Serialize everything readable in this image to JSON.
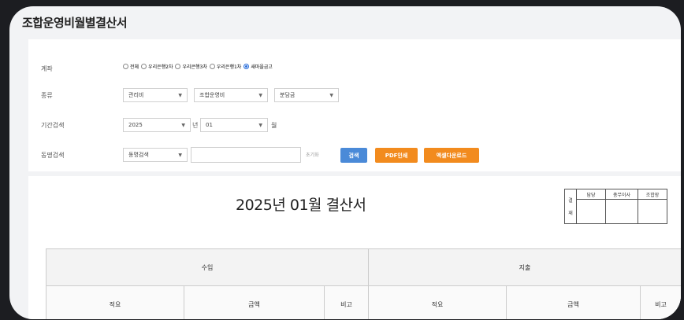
{
  "page": {
    "title": "조합운영비월별결산서"
  },
  "filters": {
    "account": {
      "label": "계좌",
      "options": [
        {
          "label": "전체",
          "checked": false
        },
        {
          "label": "우리은행2차",
          "checked": false
        },
        {
          "label": "우리은행3차",
          "checked": false
        },
        {
          "label": "우리은행1차",
          "checked": false
        },
        {
          "label": "새마을금고",
          "checked": true
        }
      ]
    },
    "category": {
      "label": "종류",
      "select1": "관리비",
      "select2": "조합운영비",
      "select3": "분담금"
    },
    "period": {
      "label": "기간검색",
      "year": "2025",
      "year_unit": "년",
      "month": "01",
      "month_unit": "월"
    },
    "member": {
      "label": "동명검색",
      "select": "동명검색",
      "input_value": "",
      "reset_label": "초기화"
    },
    "buttons": {
      "search": "검색",
      "pdf": "PDF인쇄",
      "excel": "엑셀다운로드"
    }
  },
  "sheet": {
    "title": "2025년 01월 결산서",
    "approval": {
      "side_label_1": "결",
      "side_label_2": "재",
      "headers": [
        "담당",
        "총무이사",
        "조합장"
      ]
    },
    "table": {
      "income_label": "수입",
      "expense_label": "지출",
      "columns": [
        "적요",
        "금액",
        "비고",
        "적요",
        "금액",
        "비고"
      ]
    }
  },
  "colors": {
    "accent_blue": "#4a8ad8",
    "accent_orange": "#f28b1e",
    "radio_selected": "#2a6edb"
  }
}
